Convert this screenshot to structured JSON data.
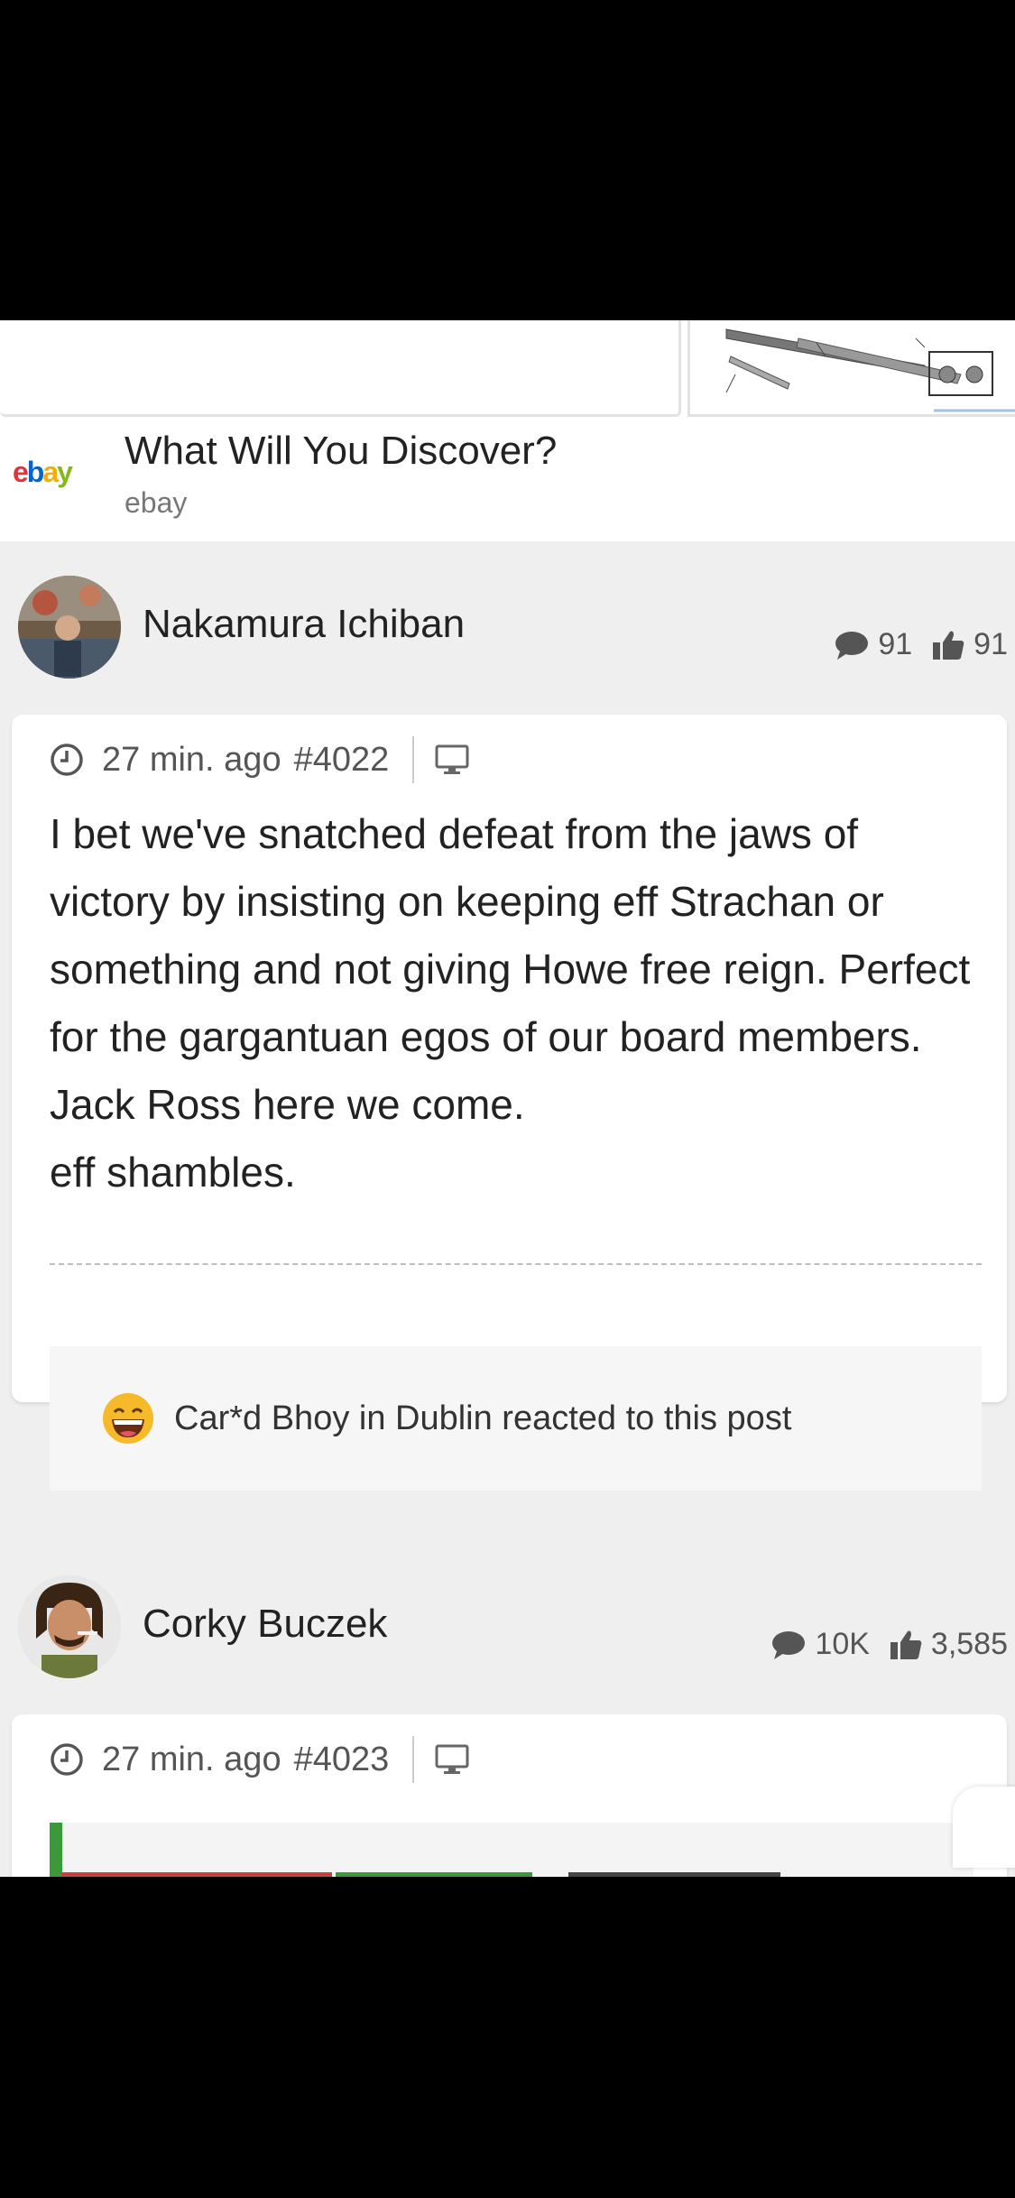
{
  "ad": {
    "logo_text": "ebay",
    "title": "What Will You Discover?",
    "source": "ebay"
  },
  "posts": [
    {
      "author": "Nakamura Ichiban",
      "comments": "91",
      "likes": "91",
      "time": "27 min. ago",
      "post_number": "#4022",
      "body": [
        "I bet we've snatched defeat from the jaws of victory by insisting on keeping eff Strachan or something and not giving Howe free reign. Perfect for the gargantuan egos of our board members. Jack Ross here we come.",
        "eff shambles."
      ],
      "reaction_text": "Car*d Bhoy in Dublin reacted to this post"
    },
    {
      "author": "Corky Buczek",
      "comments": "10K",
      "likes": "3,585",
      "time": "27 min. ago",
      "post_number": "#4023"
    }
  ],
  "colors": {
    "background": "#efefef",
    "card": "#ffffff",
    "text": "#222222",
    "muted": "#777777",
    "accent_green": "#3a9a3a"
  },
  "icons": [
    "clock-icon",
    "desktop-icon",
    "comment-icon",
    "thumbs-up-icon",
    "grin-emoji-icon"
  ]
}
